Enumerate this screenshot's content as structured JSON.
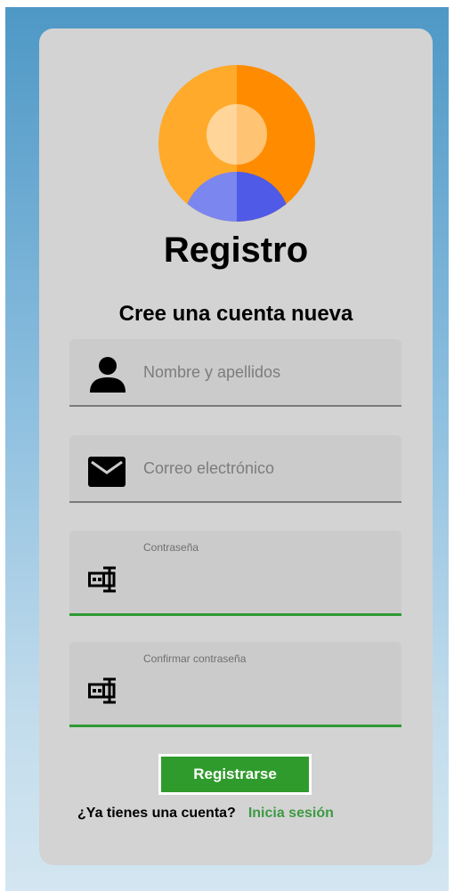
{
  "header": {
    "title": "Registro",
    "subtitle": "Cree una cuenta nueva"
  },
  "avatar": {
    "icon": "user-avatar-icon",
    "colors": {
      "bg_left": "#FFAA2A",
      "bg_right": "#FF8C00",
      "head": "#FFC87E",
      "body": "#5A63E6"
    }
  },
  "fields": {
    "name": {
      "icon": "person-icon",
      "placeholder": "Nombre y apellidos"
    },
    "email": {
      "icon": "envelope-icon",
      "placeholder": "Correo electrónico"
    },
    "password": {
      "icon": "password-icon",
      "label": "Contraseña",
      "value": ""
    },
    "confirm": {
      "icon": "password-icon",
      "label": "Confirmar contraseña",
      "value": ""
    }
  },
  "actions": {
    "register_label": "Registrarse"
  },
  "footer": {
    "question": "¿Ya tienes una cuenta?",
    "login_link": "Inicia sesión"
  },
  "colors": {
    "accent": "#2F9B2C",
    "link": "#3D9A43",
    "card": "#D3D3D3"
  }
}
